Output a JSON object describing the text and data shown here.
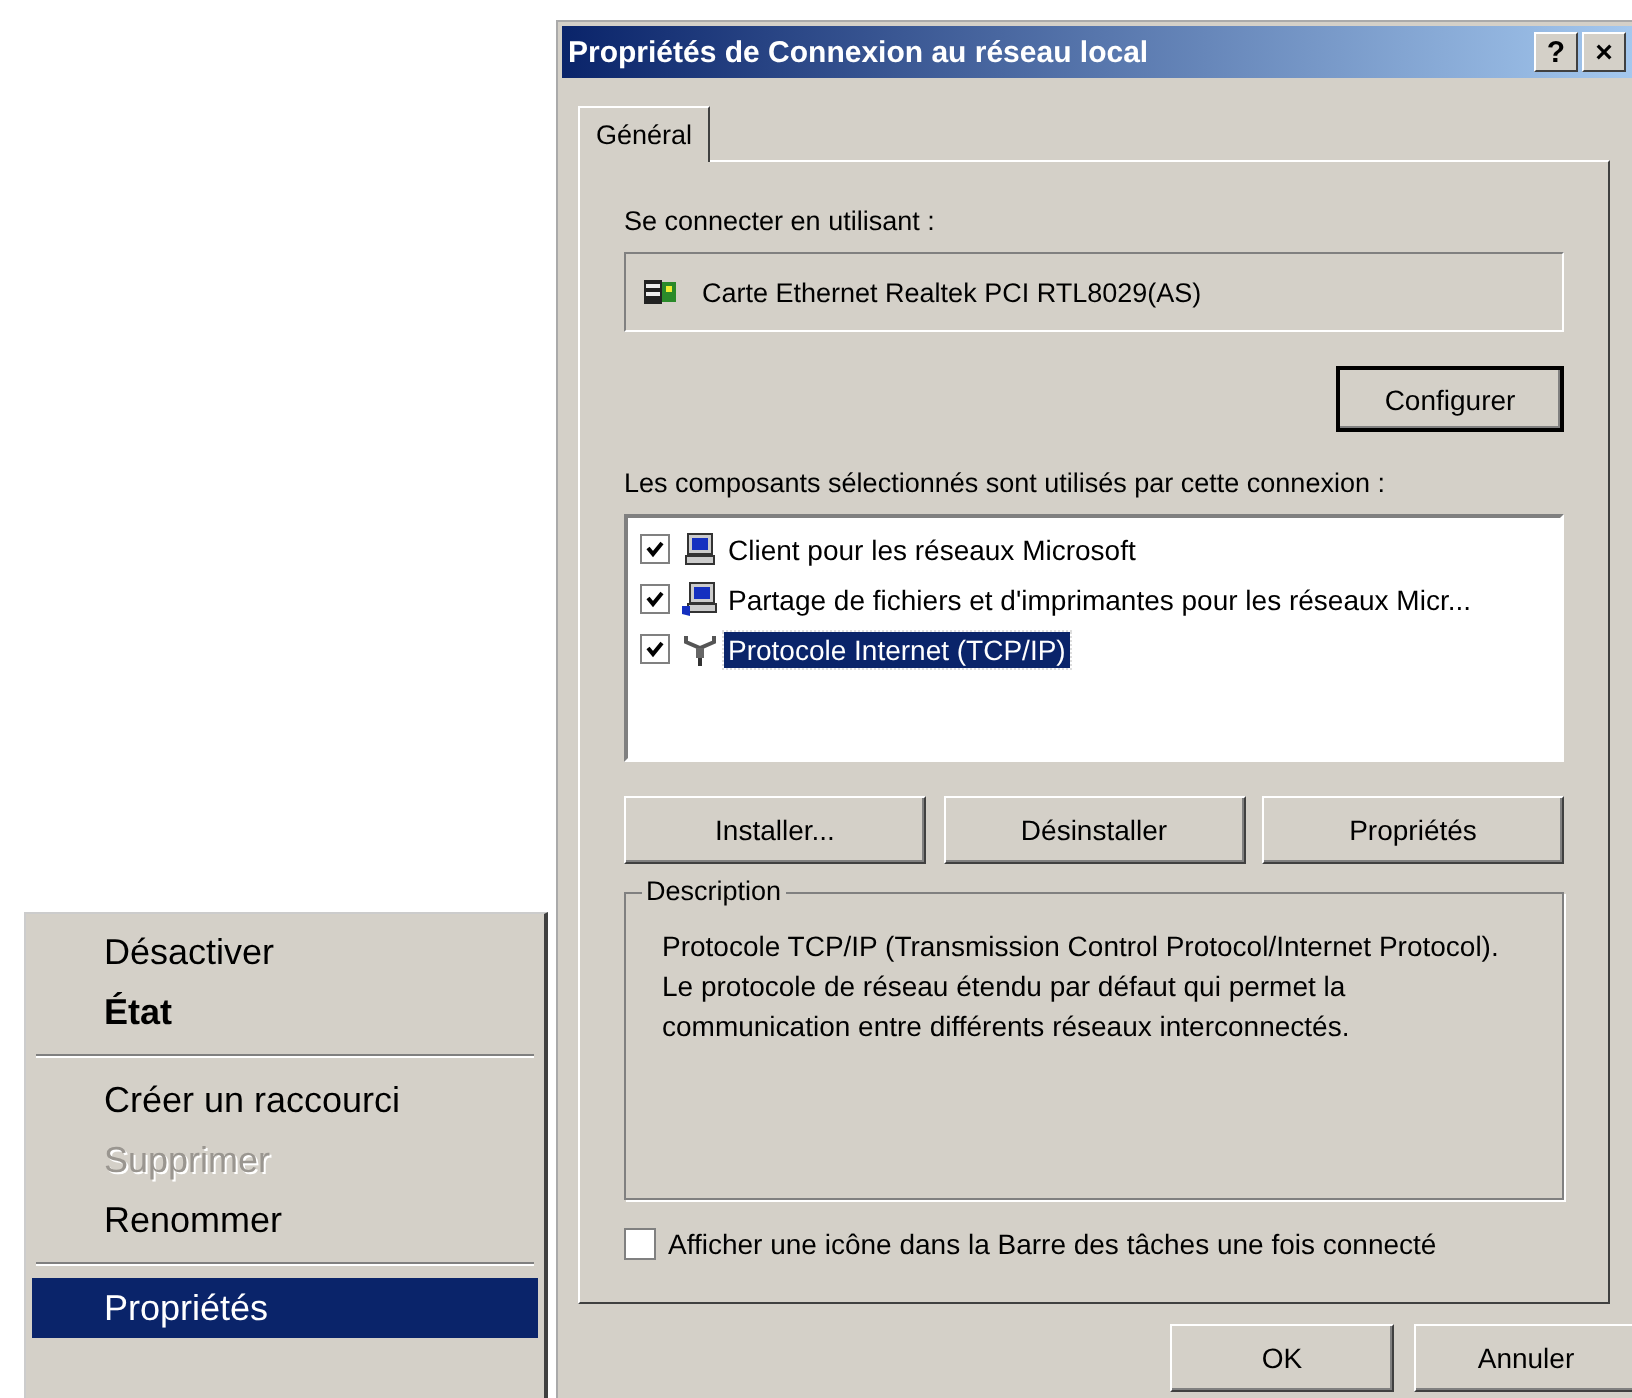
{
  "context_menu": {
    "items": [
      {
        "kind": "item",
        "label": "Désactiver",
        "bold": false,
        "disabled": false,
        "selected": false
      },
      {
        "kind": "item",
        "label": "État",
        "bold": true,
        "disabled": false,
        "selected": false
      },
      {
        "kind": "separator"
      },
      {
        "kind": "item",
        "label": "Créer un raccourci",
        "bold": false,
        "disabled": false,
        "selected": false
      },
      {
        "kind": "item",
        "label": "Supprimer",
        "bold": false,
        "disabled": true,
        "selected": false
      },
      {
        "kind": "item",
        "label": "Renommer",
        "bold": false,
        "disabled": false,
        "selected": false
      },
      {
        "kind": "separator"
      },
      {
        "kind": "item",
        "label": "Propriétés",
        "bold": false,
        "disabled": false,
        "selected": true
      }
    ]
  },
  "dialog": {
    "title": "Propriétés de Connexion au réseau local",
    "help_button": "?",
    "close_button": "×",
    "tabs": [
      {
        "label": "Général",
        "selected": true
      }
    ],
    "connect_using_label": "Se connecter en utilisant :",
    "adapter": "Carte Ethernet Realtek PCI RTL8029(AS)",
    "configure_button": "Configurer",
    "components_label": "Les composants sélectionnés sont utilisés par cette connexion :",
    "components": [
      {
        "kind": "client",
        "label": "Client pour les réseaux Microsoft",
        "checked": true,
        "selected": false
      },
      {
        "kind": "service",
        "label": "Partage de fichiers et d'imprimantes pour les réseaux Micr...",
        "checked": true,
        "selected": false
      },
      {
        "kind": "protocol",
        "label": "Protocole Internet (TCP/IP)",
        "checked": true,
        "selected": true
      }
    ],
    "component_buttons": [
      "Installer...",
      "Désinstaller",
      "Propriétés"
    ],
    "description": {
      "title": "Description",
      "text": "Protocole TCP/IP (Transmission Control Protocol/Internet Protocol). Le protocole de réseau étendu par défaut qui permet la communication entre différents réseaux interconnectés."
    },
    "taskbar_icon": {
      "label": "Afficher une icône dans la Barre des tâches une fois connecté",
      "checked": false
    },
    "buttons": [
      "OK",
      "Annuler"
    ]
  }
}
